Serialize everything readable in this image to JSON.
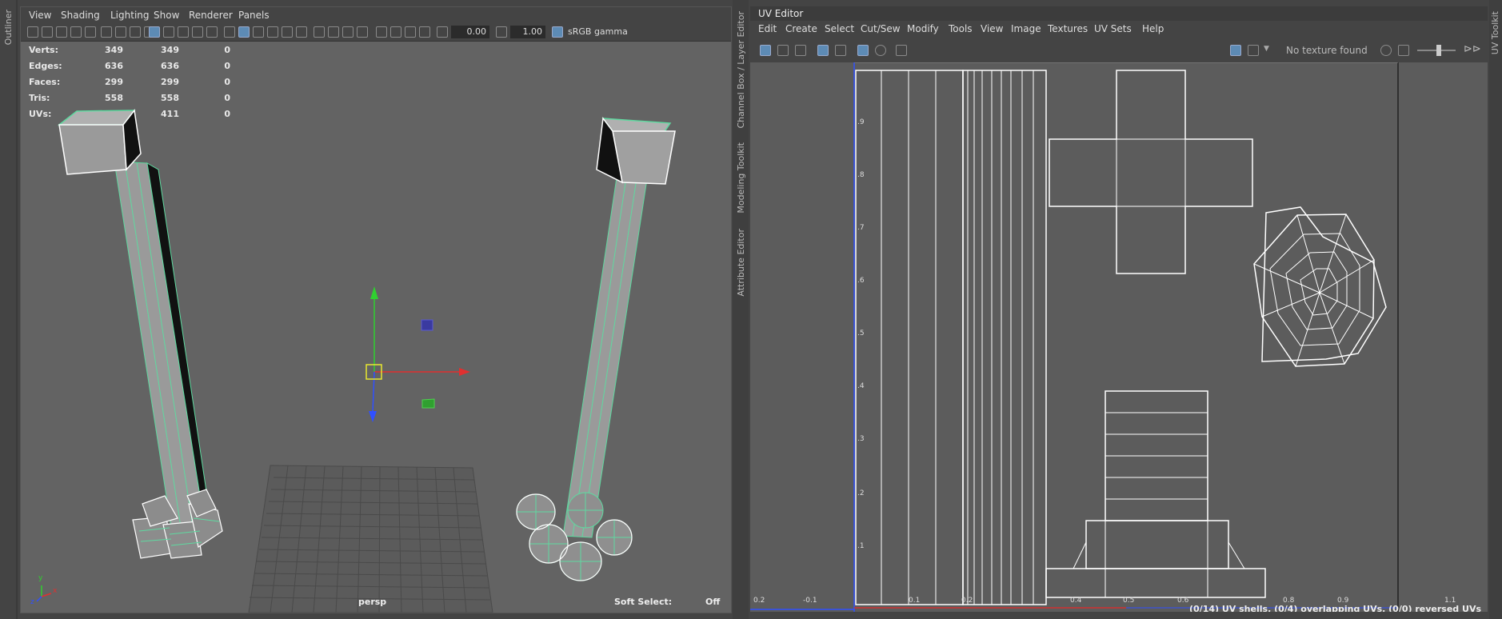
{
  "side_tabs": {
    "outliner": "Outliner",
    "channel_box": "Channel Box / Layer Editor",
    "modeling_toolkit": "Modeling Toolkit",
    "attribute_editor": "Attribute Editor",
    "uv_toolkit": "UV Toolkit"
  },
  "viewport": {
    "menu": [
      "View",
      "Shading",
      "Lighting",
      "Show",
      "Renderer",
      "Panels"
    ],
    "exposure": "0.00",
    "gamma": "1.00",
    "color_space": "sRGB gamma",
    "camera": "persp",
    "soft_select_label": "Soft Select:",
    "soft_select_value": "Off",
    "hud": [
      {
        "label": "Verts:",
        "a": "349",
        "b": "349",
        "c": "0"
      },
      {
        "label": "Edges:",
        "a": "636",
        "b": "636",
        "c": "0"
      },
      {
        "label": "Faces:",
        "a": "299",
        "b": "299",
        "c": "0"
      },
      {
        "label": "Tris:",
        "a": "558",
        "b": "558",
        "c": "0"
      },
      {
        "label": "UVs:",
        "a": "411",
        "b": "411",
        "c": "0"
      }
    ],
    "axis_labels": {
      "y": "y",
      "x": "x",
      "z": "z"
    }
  },
  "uv_editor": {
    "title": "UV Editor",
    "menu": [
      "Edit",
      "Create",
      "Select",
      "Cut/Sew",
      "Modify",
      "Tools",
      "View",
      "Image",
      "Textures",
      "UV Sets",
      "Help"
    ],
    "texture_status": "No texture found",
    "v_ticks": [
      ".9",
      ".8",
      ".7",
      ".6",
      ".5",
      ".4",
      ".3",
      ".2",
      ".1"
    ],
    "u_ticks": [
      "0.2",
      "-0.1",
      "0.1",
      "0.2",
      "0.4",
      "0.5",
      "0.6",
      "0.8",
      "0.9",
      "1.1"
    ],
    "status": "(0/14) UV shells, (0/4) overlapping UVs, (0/0) reversed UVs"
  },
  "colors": {
    "accent_wire": "#5fd9a0",
    "manip_x": "#e03030",
    "manip_y": "#30d030",
    "manip_z": "#3050ff",
    "uv_line": "#ffffff"
  }
}
